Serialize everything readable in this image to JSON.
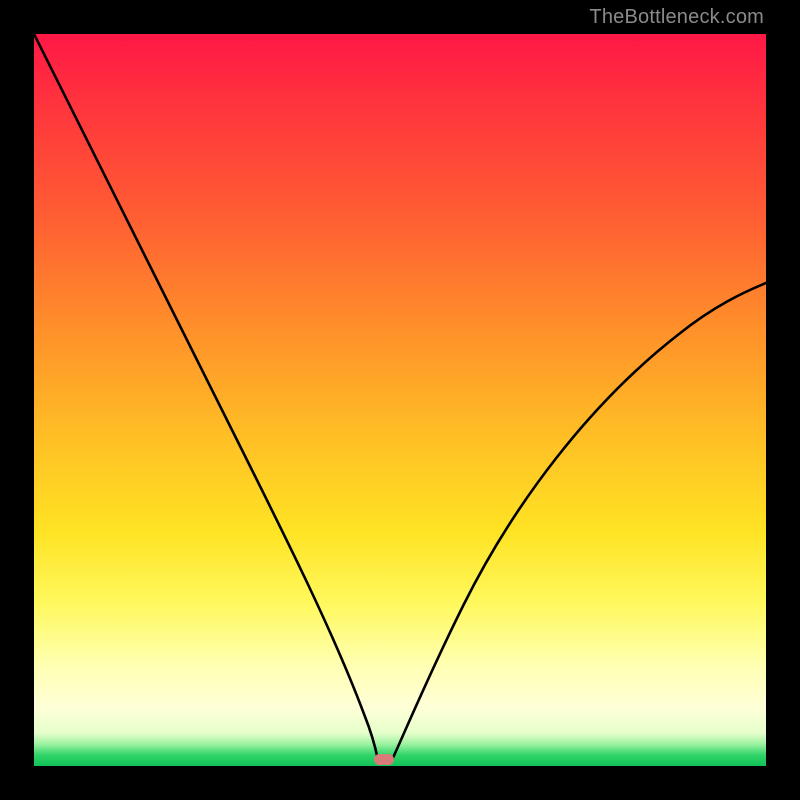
{
  "watermark": "TheBottleneck.com",
  "marker": {
    "cx_frac": 0.478,
    "cy_frac": 0.991,
    "color": "#d97b78"
  },
  "chart_data": {
    "type": "line",
    "title": "",
    "xlabel": "",
    "ylabel": "",
    "xlim": [
      0,
      1
    ],
    "ylim": [
      0,
      1
    ],
    "grid": false,
    "legend": false,
    "background_gradient": [
      "#ff1846",
      "#ff8f2a",
      "#ffe324",
      "#ffffd8",
      "#10c257"
    ],
    "series": [
      {
        "name": "left-branch",
        "x": [
          0.0,
          0.05,
          0.1,
          0.15,
          0.2,
          0.25,
          0.3,
          0.35,
          0.4,
          0.43,
          0.45,
          0.47
        ],
        "y": [
          1.0,
          0.88,
          0.77,
          0.66,
          0.55,
          0.44,
          0.33,
          0.22,
          0.11,
          0.048,
          0.018,
          0.005
        ]
      },
      {
        "name": "right-branch",
        "x": [
          0.49,
          0.52,
          0.56,
          0.61,
          0.67,
          0.74,
          0.82,
          0.91,
          1.0
        ],
        "y": [
          0.005,
          0.035,
          0.1,
          0.19,
          0.295,
          0.4,
          0.5,
          0.59,
          0.66
        ]
      }
    ],
    "annotations": [
      {
        "type": "marker",
        "x": 0.478,
        "y": 0.009,
        "shape": "pill",
        "color": "#d97b78"
      }
    ]
  }
}
